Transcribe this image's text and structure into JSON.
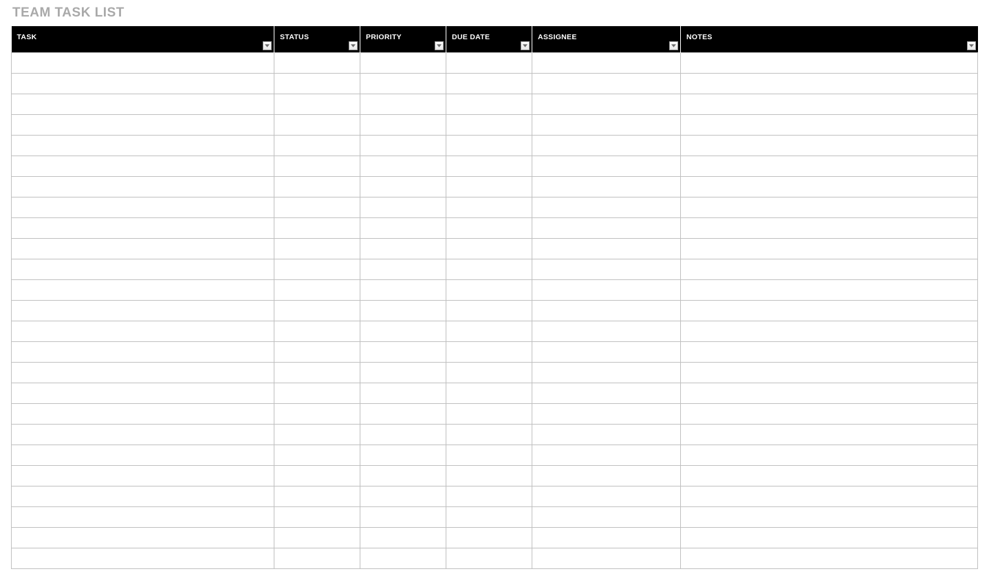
{
  "title": "TEAM TASK LIST",
  "columns": [
    {
      "id": "task",
      "label": "TASK",
      "has_filter": true
    },
    {
      "id": "status",
      "label": "STATUS",
      "has_filter": true
    },
    {
      "id": "priority",
      "label": "PRIORITY",
      "has_filter": true
    },
    {
      "id": "due_date",
      "label": "DUE DATE",
      "has_filter": true
    },
    {
      "id": "assignee",
      "label": "ASSIGNEE",
      "has_filter": true
    },
    {
      "id": "notes",
      "label": "NOTES",
      "has_filter": true
    }
  ],
  "rows": [
    {
      "task": "",
      "status": "",
      "priority": "",
      "due_date": "",
      "assignee": "",
      "notes": ""
    },
    {
      "task": "",
      "status": "",
      "priority": "",
      "due_date": "",
      "assignee": "",
      "notes": ""
    },
    {
      "task": "",
      "status": "",
      "priority": "",
      "due_date": "",
      "assignee": "",
      "notes": ""
    },
    {
      "task": "",
      "status": "",
      "priority": "",
      "due_date": "",
      "assignee": "",
      "notes": ""
    },
    {
      "task": "",
      "status": "",
      "priority": "",
      "due_date": "",
      "assignee": "",
      "notes": ""
    },
    {
      "task": "",
      "status": "",
      "priority": "",
      "due_date": "",
      "assignee": "",
      "notes": ""
    },
    {
      "task": "",
      "status": "",
      "priority": "",
      "due_date": "",
      "assignee": "",
      "notes": ""
    },
    {
      "task": "",
      "status": "",
      "priority": "",
      "due_date": "",
      "assignee": "",
      "notes": ""
    },
    {
      "task": "",
      "status": "",
      "priority": "",
      "due_date": "",
      "assignee": "",
      "notes": ""
    },
    {
      "task": "",
      "status": "",
      "priority": "",
      "due_date": "",
      "assignee": "",
      "notes": ""
    },
    {
      "task": "",
      "status": "",
      "priority": "",
      "due_date": "",
      "assignee": "",
      "notes": ""
    },
    {
      "task": "",
      "status": "",
      "priority": "",
      "due_date": "",
      "assignee": "",
      "notes": ""
    },
    {
      "task": "",
      "status": "",
      "priority": "",
      "due_date": "",
      "assignee": "",
      "notes": ""
    },
    {
      "task": "",
      "status": "",
      "priority": "",
      "due_date": "",
      "assignee": "",
      "notes": ""
    },
    {
      "task": "",
      "status": "",
      "priority": "",
      "due_date": "",
      "assignee": "",
      "notes": ""
    },
    {
      "task": "",
      "status": "",
      "priority": "",
      "due_date": "",
      "assignee": "",
      "notes": ""
    },
    {
      "task": "",
      "status": "",
      "priority": "",
      "due_date": "",
      "assignee": "",
      "notes": ""
    },
    {
      "task": "",
      "status": "",
      "priority": "",
      "due_date": "",
      "assignee": "",
      "notes": ""
    },
    {
      "task": "",
      "status": "",
      "priority": "",
      "due_date": "",
      "assignee": "",
      "notes": ""
    },
    {
      "task": "",
      "status": "",
      "priority": "",
      "due_date": "",
      "assignee": "",
      "notes": ""
    },
    {
      "task": "",
      "status": "",
      "priority": "",
      "due_date": "",
      "assignee": "",
      "notes": ""
    },
    {
      "task": "",
      "status": "",
      "priority": "",
      "due_date": "",
      "assignee": "",
      "notes": ""
    },
    {
      "task": "",
      "status": "",
      "priority": "",
      "due_date": "",
      "assignee": "",
      "notes": ""
    },
    {
      "task": "",
      "status": "",
      "priority": "",
      "due_date": "",
      "assignee": "",
      "notes": ""
    },
    {
      "task": "",
      "status": "",
      "priority": "",
      "due_date": "",
      "assignee": "",
      "notes": ""
    }
  ]
}
